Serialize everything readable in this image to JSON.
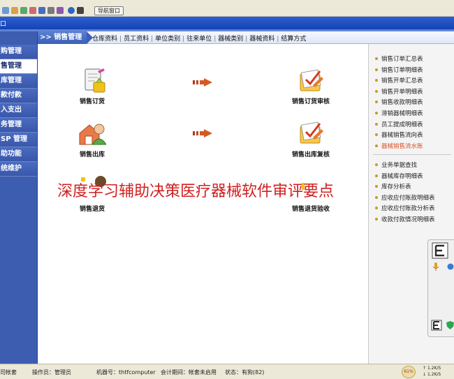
{
  "toolbar": {
    "nav_window_label": "导航窗口"
  },
  "titlebar": {
    "title": "口"
  },
  "sidebar": {
    "items": [
      {
        "label": "购管理",
        "active": false
      },
      {
        "label": "售管理",
        "active": true
      },
      {
        "label": "库管理",
        "active": false
      },
      {
        "label": "款付款",
        "active": false
      },
      {
        "label": "入支出",
        "active": false
      },
      {
        "label": "务管理",
        "active": false
      },
      {
        "label": "SP 管理",
        "active": false
      },
      {
        "label": "助功能",
        "active": false
      },
      {
        "label": "统维护",
        "active": false
      }
    ]
  },
  "header": {
    "module_title": ">> 销售管理",
    "tabs": [
      "仓库资料",
      "员工资料",
      "单位类别",
      "往来单位",
      "器械类别",
      "器械资料",
      "结算方式"
    ]
  },
  "workflow": {
    "nodes": {
      "order": "销售订货",
      "order_review": "销售订货审核",
      "outbound": "销售出库",
      "outbound_review": "销售出库复核",
      "return": "销售退货",
      "return_accept": "销售退货验收"
    }
  },
  "reports": {
    "group1": [
      {
        "label": "销售订单汇总表",
        "highlight": false
      },
      {
        "label": "销售订单明细表",
        "highlight": false
      },
      {
        "label": "销售开单汇总表",
        "highlight": false
      },
      {
        "label": "销售开单明细表",
        "highlight": false
      },
      {
        "label": "销售收款明细表",
        "highlight": false
      },
      {
        "label": "滞销器械明细表",
        "highlight": false
      },
      {
        "label": "员工提成明细表",
        "highlight": false
      },
      {
        "label": "器械销售流向表",
        "highlight": false
      },
      {
        "label": "器械销售流水账",
        "highlight": true
      }
    ],
    "group2": [
      {
        "label": "业务单据查找"
      },
      {
        "label": "器械库存明细表"
      },
      {
        "label": "库存分析表"
      },
      {
        "label": "应收应付账款明细表"
      },
      {
        "label": "应收应付账款分析表"
      },
      {
        "label": "收款付款情况明细表"
      }
    ]
  },
  "watermark": {
    "text": "深度学习辅助决策医疗器械软件审评要点"
  },
  "status": {
    "account": "司帐套",
    "operator": "操作员：管理员",
    "machine": "机器号：thtfcomputer",
    "period": "会计期间：帐套未启用",
    "state": "状态：有狗(82)",
    "speed_pct": "61%",
    "upload": "1.2K/S",
    "download": "1.2K/S"
  },
  "colors": {
    "titlebar": "#2b5fd3",
    "sidebar": "#3d5db1",
    "watermark": "#d02020",
    "highlight_report": "#d9532b"
  }
}
